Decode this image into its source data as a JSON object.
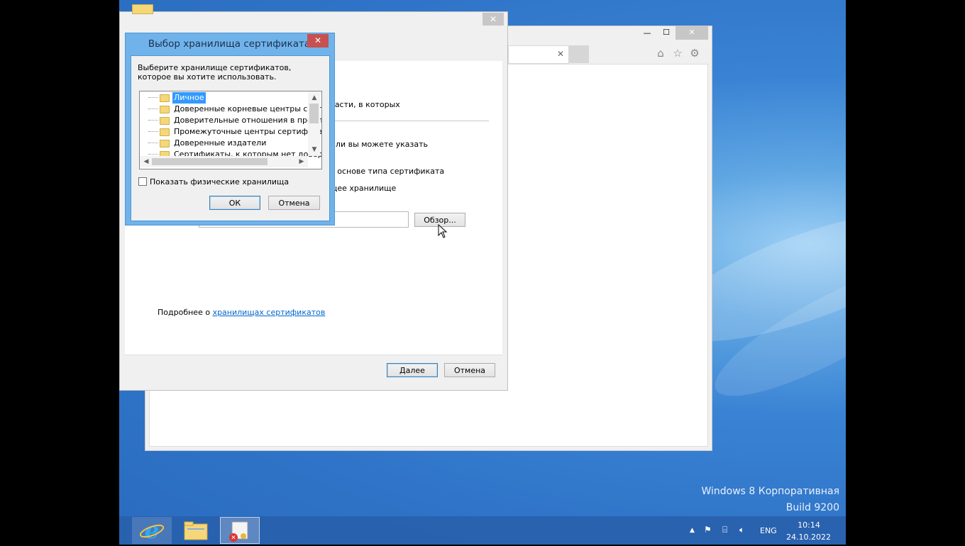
{
  "wizard": {
    "partial_text_1": "бласти, в которых",
    "partial_text_2": "е, или вы можете указать",
    "partial_text_3": "а основе типа сертификата",
    "partial_text_4": "щее хранилище",
    "browse_label": "Обзор...",
    "more_prefix": "Подробнее о ",
    "more_link": "хранилищах сертификатов",
    "next_label": "Далее",
    "cancel_label": "Отмена",
    "close_glyph": "✕"
  },
  "dialog": {
    "title": "Выбор хранилища сертификата",
    "prompt": "Выберите хранилище сертификатов, которое вы хотите использовать.",
    "tree_items": [
      {
        "label": "Личное",
        "selected": true
      },
      {
        "label": "Доверенные корневые центры сертиф",
        "selected": false
      },
      {
        "label": "Доверительные отношения в предпри",
        "selected": false
      },
      {
        "label": "Промежуточные центры сертификаци",
        "selected": false
      },
      {
        "label": "Доверенные издатели",
        "selected": false
      },
      {
        "label": "Сертификаты, к которым нет довери",
        "selected": false
      }
    ],
    "show_physical_label": "Показать физические хранилища",
    "show_physical_checked": false,
    "ok_label": "ОК",
    "cancel_label": "Отмена",
    "close_glyph": "✕"
  },
  "ie": {
    "tab_close_glyph": "✕",
    "min_glyph": "—",
    "max_glyph": "☐",
    "close_glyph": "✕",
    "home_icon": "home-icon",
    "favorites_icon": "star-icon",
    "tools_icon": "gear-icon"
  },
  "watermark": {
    "line1": "Windows 8 Корпоративная",
    "line2": "Build 9200"
  },
  "taskbar": {
    "apps": [
      "ie-icon",
      "file-explorer-icon",
      "certificate-manager-icon"
    ],
    "language": "ENG",
    "time": "10:14",
    "date": "24.10.2022"
  }
}
